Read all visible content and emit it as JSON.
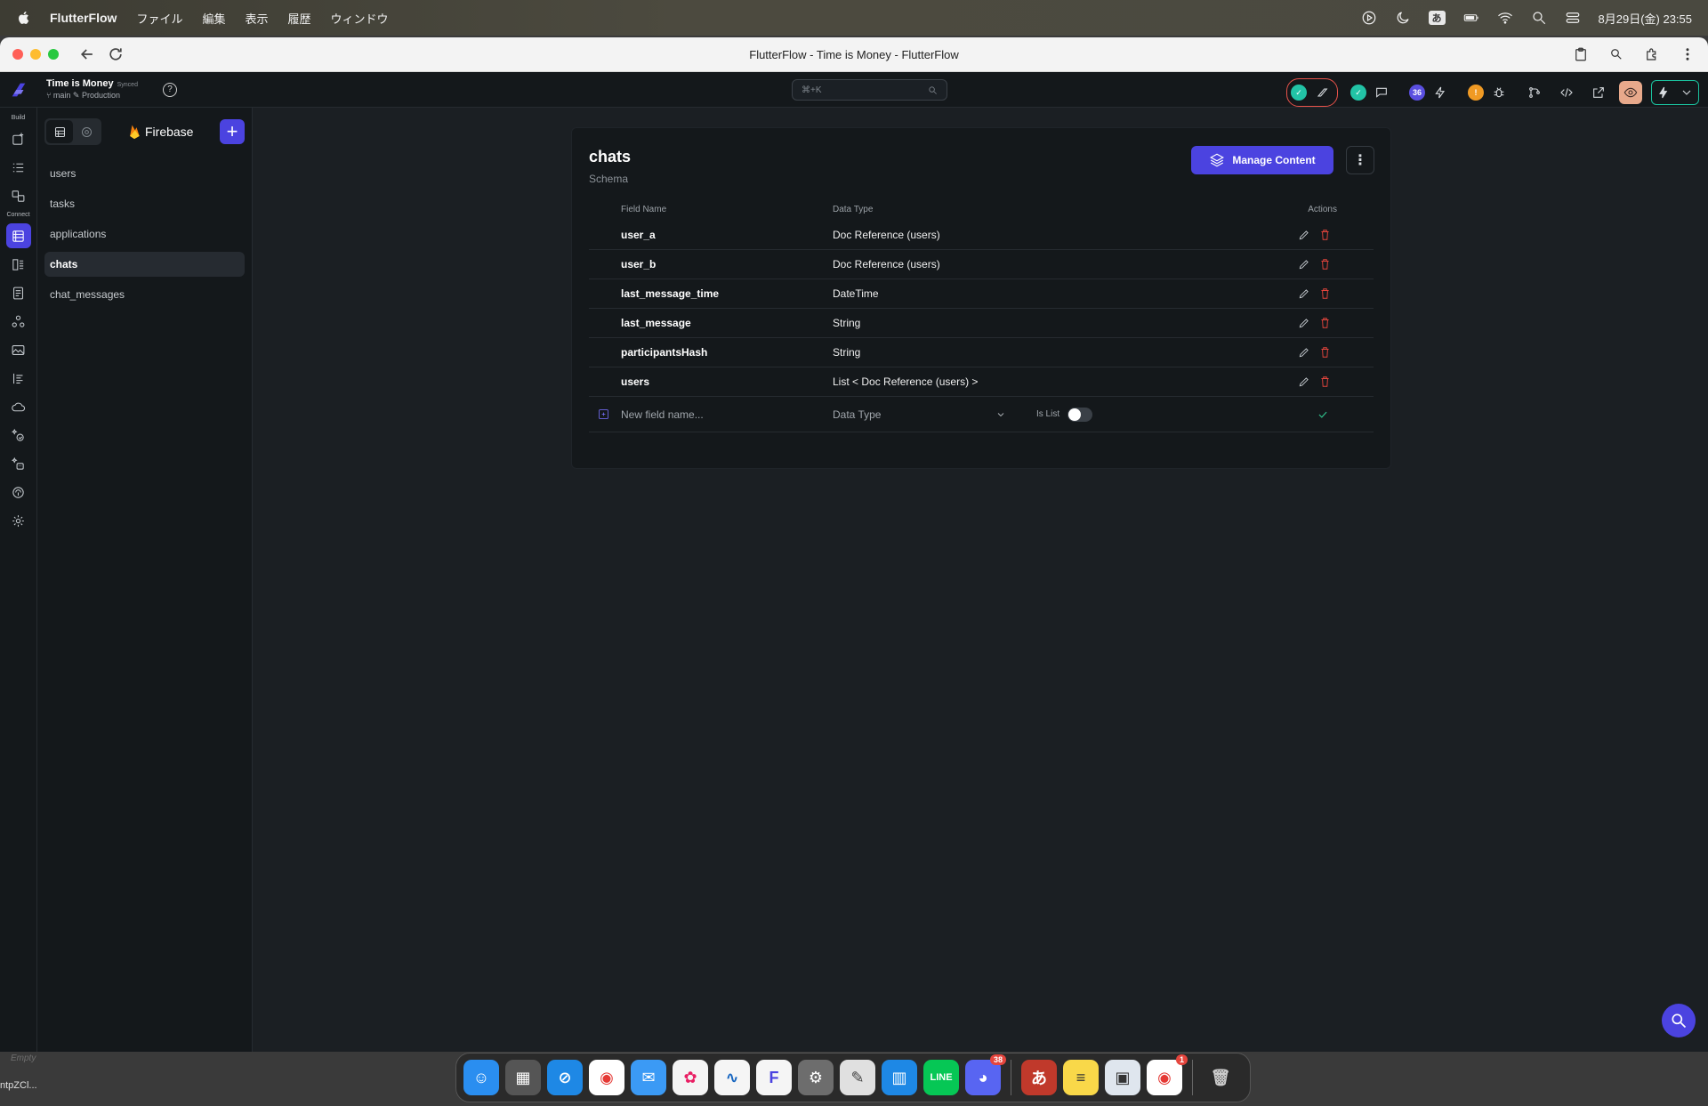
{
  "menubar": {
    "app_name": "FlutterFlow",
    "items": [
      "ファイル",
      "編集",
      "表示",
      "履歴",
      "ウィンドウ"
    ],
    "ime": "あ",
    "datetime": "8月29日(金)  23:55"
  },
  "browser": {
    "title": "FlutterFlow - Time is Money - FlutterFlow"
  },
  "header": {
    "project_name": "Time is Money",
    "sync_status": "Synced",
    "branch": "main",
    "environment": "Production",
    "search_placeholder": "⌘+K",
    "notification_count": "36",
    "accent_color": "#4b43e0"
  },
  "rail": {
    "build_label": "Build",
    "connect_label": "Connect"
  },
  "collections_panel": {
    "provider": "Firebase",
    "items": [
      {
        "label": "users"
      },
      {
        "label": "tasks"
      },
      {
        "label": "applications"
      },
      {
        "label": "chats"
      },
      {
        "label": "chat_messages"
      }
    ],
    "active": "chats"
  },
  "schema_card": {
    "title": "chats",
    "subtitle": "Schema",
    "manage_button": "Manage Content",
    "columns": {
      "field_name": "Field Name",
      "data_type": "Data Type",
      "actions": "Actions"
    },
    "fields": [
      {
        "name": "user_a",
        "type": "Doc Reference (users)"
      },
      {
        "name": "user_b",
        "type": "Doc Reference (users)"
      },
      {
        "name": "last_message_time",
        "type": "DateTime"
      },
      {
        "name": "last_message",
        "type": "String"
      },
      {
        "name": "participantsHash",
        "type": "String"
      },
      {
        "name": "users",
        "type": "List < Doc Reference (users) >"
      }
    ],
    "new_field": {
      "placeholder": "New field name...",
      "data_type_placeholder": "Data Type",
      "is_list_label": "Is List",
      "is_list": false
    }
  },
  "desktop": {
    "empty_label": "Empty",
    "file_label": "ntpZCl..."
  },
  "dock": {
    "badges": {
      "discord": "38",
      "chrome": "1"
    }
  }
}
